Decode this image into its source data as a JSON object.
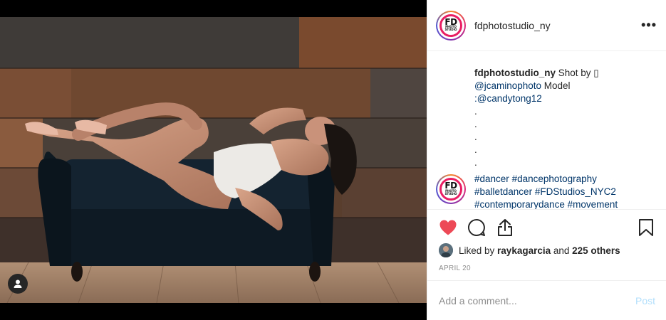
{
  "post": {
    "username": "fdphotostudio_ny",
    "more_label": "•••",
    "avatar_logo": {
      "big": "FD",
      "small": "PHOTO STUDIO"
    },
    "caption": {
      "username": "fdphotostudio_ny",
      "text_1": " Shot by ",
      "emoji_box": "▯",
      "mention_1": "@jcaminophoto",
      "text_2": " Model",
      "mention_2": ":@candytong12",
      "dots": [
        ".",
        ".",
        ".",
        ".",
        "."
      ]
    },
    "hashtags": [
      "#dancer",
      "#dancephotography",
      "#balletdancer",
      "#FDStudios_NYC2",
      "#contemporarydance",
      "#movement"
    ],
    "likes": {
      "prefix": "Liked by ",
      "user": "raykagarcia",
      "middle": " and ",
      "others": "225 others"
    },
    "date": "APRIL 20",
    "add_comment_placeholder": "Add a comment...",
    "post_label": "Post",
    "icons": {
      "like": "heart-icon",
      "comment": "comment-icon",
      "share": "share-icon",
      "save": "bookmark-icon",
      "tag": "user-tag-icon"
    },
    "colors": {
      "liked": "#ed4956",
      "link": "#003569",
      "post_disabled": "#b2dffc",
      "muted": "#8e8e8e"
    }
  }
}
